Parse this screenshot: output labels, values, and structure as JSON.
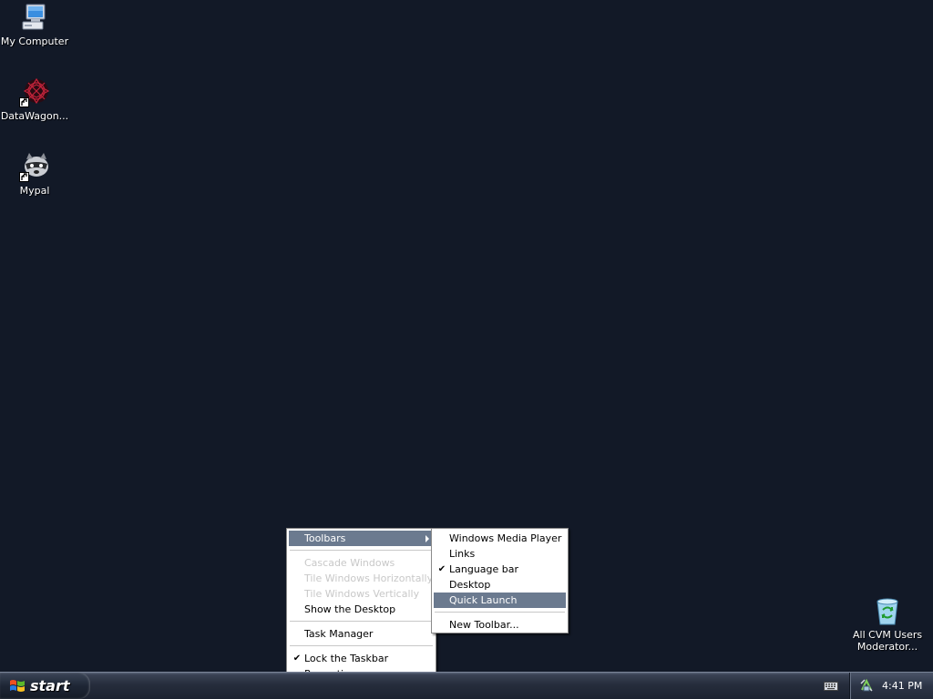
{
  "desktop": {
    "background_color": "#121927",
    "icons": [
      {
        "label": "My Computer",
        "icon": "my-computer-icon"
      },
      {
        "label": "DataWagon...",
        "icon": "datawagon-icon"
      },
      {
        "label": "Mypal",
        "icon": "mypal-icon"
      },
      {
        "label": "All CVM Users Moderator...",
        "line1": "All CVM Users",
        "line2": "Moderator...",
        "icon": "recycle-bin-icon"
      }
    ]
  },
  "context_menu": {
    "items": [
      {
        "label": "Toolbars",
        "state": "highlighted",
        "has_submenu": true
      },
      {
        "label": "Cascade Windows",
        "state": "disabled"
      },
      {
        "label": "Tile Windows Horizontally",
        "state": "disabled"
      },
      {
        "label": "Tile Windows Vertically",
        "state": "disabled"
      },
      {
        "label": "Show the Desktop",
        "state": "enabled"
      },
      {
        "label": "Task Manager",
        "state": "enabled"
      },
      {
        "label": "Lock the Taskbar",
        "state": "checked"
      },
      {
        "label": "Properties",
        "state": "enabled"
      }
    ]
  },
  "toolbars_submenu": {
    "items": [
      {
        "label": "Windows Media Player",
        "checked": false
      },
      {
        "label": "Links",
        "checked": false
      },
      {
        "label": "Language bar",
        "checked": true
      },
      {
        "label": "Desktop",
        "checked": false
      },
      {
        "label": "Quick Launch",
        "checked": false,
        "state": "highlighted"
      },
      {
        "label": "New Toolbar...",
        "checked": false
      }
    ]
  },
  "taskbar": {
    "start_label": "start",
    "clock": "4:41 PM",
    "highlight_color": "#6b7a8f"
  }
}
